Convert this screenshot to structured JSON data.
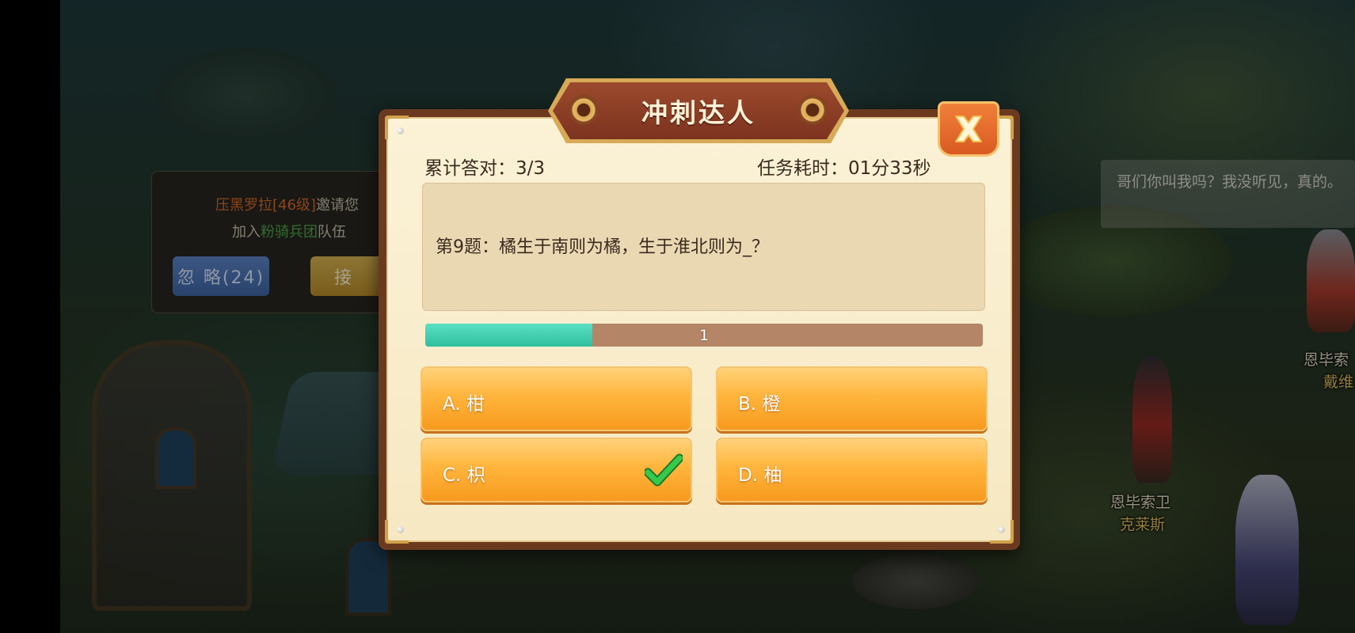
{
  "invite": {
    "line1_name": "压黑罗拉[46级]",
    "line1_suffix": "邀请您",
    "line2_prefix": "加入",
    "line2_team": "粉骑兵团",
    "line2_suffix": "队伍",
    "ignore_label": "忽 略(24)",
    "accept_label": "接"
  },
  "chat": {
    "text": "哥们你叫我吗？我没听见，真的。"
  },
  "characters": {
    "name1_top": "恩毕索",
    "name1_bottom": "戴维",
    "name2_top": "恩毕索卫",
    "name2_bottom": "克莱斯"
  },
  "quiz": {
    "title": "冲刺达人",
    "correct_count": "累计答对：3/3",
    "elapsed_time": "任务耗时：01分33秒",
    "question": "第9题：橘生于南则为橘，生于淮北则为_？",
    "progress_label": "1",
    "progress_fraction": 0.3,
    "options": [
      {
        "label": "A.  柑",
        "correct": false
      },
      {
        "label": "B.  橙",
        "correct": false
      },
      {
        "label": "C.  枳",
        "correct": true
      },
      {
        "label": "D.  柚",
        "correct": false
      }
    ]
  },
  "colors": {
    "progress_fill": "#3fcfae",
    "option_orange": "#f9a42a",
    "check_green": "#2fbf3a",
    "panel_cream": "#f8edcc"
  }
}
